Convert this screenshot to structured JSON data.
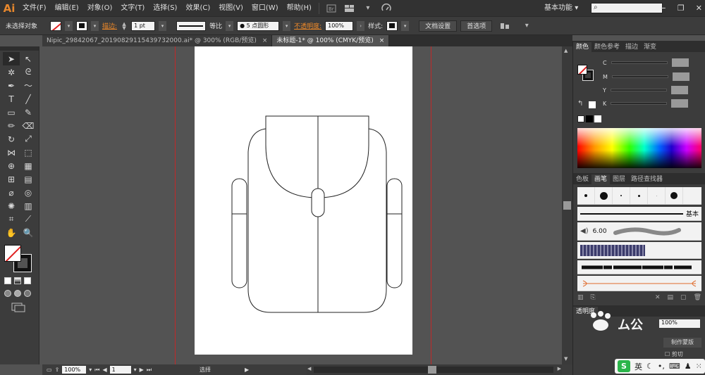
{
  "app": {
    "logo": "Ai"
  },
  "menubar": {
    "items": [
      "文件(F)",
      "编辑(E)",
      "对象(O)",
      "文字(T)",
      "选择(S)",
      "效果(C)",
      "视图(V)",
      "窗口(W)",
      "帮助(H)"
    ],
    "workspace": "基本功能",
    "workspace_caret": "▾",
    "search_placeholder": ""
  },
  "controlbar": {
    "selection_label": "未选择对象",
    "stroke_label": "描边:",
    "stroke_weight": "1 pt",
    "profile_label": "等比",
    "brush_label": "5 点圆形",
    "opacity_label": "不透明度:",
    "opacity_value": "100%",
    "style_label": "样式:",
    "doc_setup_button": "文档设置",
    "preferences_button": "首选项"
  },
  "tabs": [
    {
      "label": "Nipic_29842067_20190829115439732000.ai* @ 300% (RGB/预览)",
      "active": false,
      "close": "×"
    },
    {
      "label": "未标题-1* @ 100% (CMYK/预览)",
      "active": true,
      "close": "×"
    }
  ],
  "statusbar": {
    "zoom": "100%",
    "artboard": "1",
    "tool_status": "选择"
  },
  "panels": {
    "color_tabs": [
      "颜色",
      "颜色参考",
      "描边",
      "渐变"
    ],
    "channels": [
      "C",
      "M",
      "Y",
      "K"
    ],
    "brush_tabs": [
      "色板",
      "画笔",
      "图层",
      "路径查找器"
    ],
    "basic_brush": "基本",
    "brush_size": "6.00",
    "transparency_tab": "透明度",
    "transparency_value": "100%",
    "make_mask_button": "制作蒙版",
    "clip_label": "剪切"
  },
  "taskbar": {
    "ime_logo": "S",
    "ime_lang": "英",
    "watermark": "ム公"
  },
  "colors": {
    "menubar": "#323232",
    "panel": "#3c3c3c",
    "canvas": "#535353",
    "guide": "#d42222",
    "accent": "#f08a28",
    "ime_green": "#2bb54a"
  },
  "icons": {
    "tools": [
      "selection-tool-icon",
      "direct-selection-tool-icon",
      "magic-wand-tool-icon",
      "lasso-tool-icon",
      "pen-tool-icon",
      "curvature-tool-icon",
      "type-tool-icon",
      "line-segment-tool-icon",
      "rectangle-tool-icon",
      "paintbrush-tool-icon",
      "pencil-tool-icon",
      "eraser-tool-icon",
      "rotate-tool-icon",
      "scale-tool-icon",
      "width-tool-icon",
      "free-transform-tool-icon",
      "shape-builder-tool-icon",
      "perspective-grid-tool-icon",
      "mesh-tool-icon",
      "gradient-tool-icon",
      "eyedropper-tool-icon",
      "blend-tool-icon",
      "symbol-sprayer-tool-icon",
      "column-graph-tool-icon",
      "artboard-tool-icon",
      "slice-tool-icon",
      "hand-tool-icon",
      "zoom-tool-icon"
    ]
  }
}
